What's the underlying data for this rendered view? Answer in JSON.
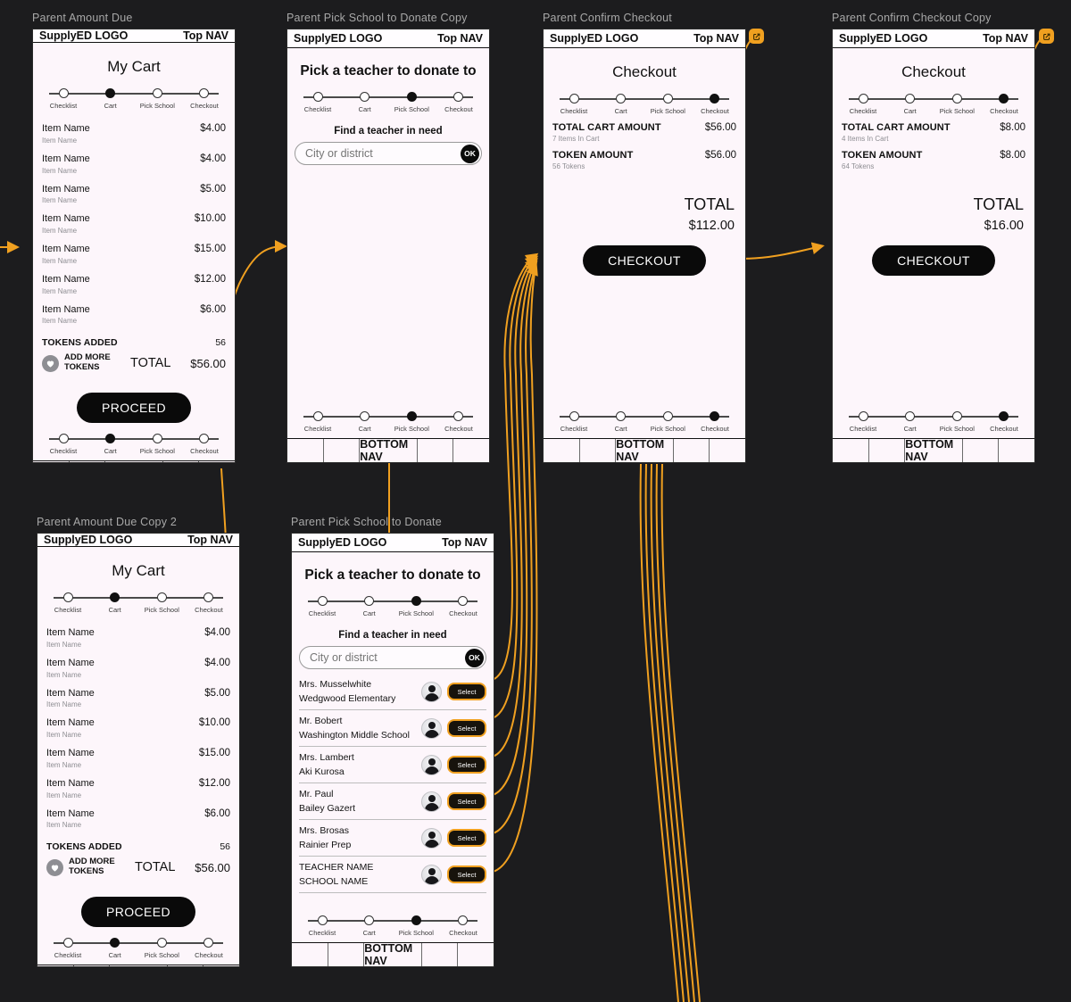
{
  "canvas": {
    "bg": "#1c1c1e",
    "accent": "#f0a020"
  },
  "common": {
    "logo": "SupplyED LOGO",
    "top_nav": "Top NAV",
    "bottom_nav": "BOTTOM NAV",
    "stepper": [
      "Checklist",
      "Cart",
      "Pick School",
      "Checkout"
    ]
  },
  "frames": [
    {
      "title": "Parent Amount Due",
      "screen_title": "My Cart",
      "title_style": "light",
      "active_step": 1,
      "items": [
        {
          "name": "Item Name",
          "sub": "Item Name",
          "price": "$4.00"
        },
        {
          "name": "Item Name",
          "sub": "Item Name",
          "price": "$4.00"
        },
        {
          "name": "Item Name",
          "sub": "Item Name",
          "price": "$5.00"
        },
        {
          "name": "Item Name",
          "sub": "Item Name",
          "price": "$10.00"
        },
        {
          "name": "Item Name",
          "sub": "Item Name",
          "price": "$15.00"
        },
        {
          "name": "Item Name",
          "sub": "Item Name",
          "price": "$12.00"
        },
        {
          "name": "Item Name",
          "sub": "Item Name",
          "price": "$6.00"
        }
      ],
      "tokens_added_label": "TOKENS ADDED",
      "tokens_added_count": "56",
      "add_more_tokens": "ADD MORE TOKENS",
      "total_word": "TOTAL",
      "total_value": "$56.00",
      "cta": "PROCEED"
    },
    {
      "title": "Parent Pick School to Donate Copy",
      "screen_title": "Pick a teacher to donate to",
      "title_style": "bold",
      "active_step": 2,
      "find_label": "Find a teacher in need",
      "search_placeholder": "City or district",
      "search_value": "",
      "ok_label": "OK",
      "teachers": []
    },
    {
      "title": "Parent Confirm Checkout",
      "screen_title": "Checkout",
      "title_style": "light",
      "active_step": 3,
      "summary": [
        {
          "label": "TOTAL CART AMOUNT",
          "sub": "7 Items In Cart",
          "value": "$56.00"
        },
        {
          "label": "TOKEN AMOUNT",
          "sub": "56 Tokens",
          "value": "$56.00"
        }
      ],
      "grand_word": "TOTAL",
      "grand_value": "$112.00",
      "cta": "CHECKOUT",
      "ext_link": true
    },
    {
      "title": "Parent Confirm Checkout Copy",
      "screen_title": "Checkout",
      "title_style": "light",
      "active_step": 3,
      "summary": [
        {
          "label": "TOTAL CART AMOUNT",
          "sub": "4 Items In Cart",
          "value": "$8.00"
        },
        {
          "label": "TOKEN AMOUNT",
          "sub": "64 Tokens",
          "value": "$8.00"
        }
      ],
      "grand_word": "TOTAL",
      "grand_value": "$16.00",
      "cta": "CHECKOUT",
      "ext_link": true
    },
    {
      "title": "Parent Amount Due Copy 2",
      "screen_title": "My Cart",
      "title_style": "light",
      "active_step": 1,
      "items": [
        {
          "name": "Item Name",
          "sub": "Item Name",
          "price": "$4.00"
        },
        {
          "name": "Item Name",
          "sub": "Item Name",
          "price": "$4.00"
        },
        {
          "name": "Item Name",
          "sub": "Item Name",
          "price": "$5.00"
        },
        {
          "name": "Item Name",
          "sub": "Item Name",
          "price": "$10.00"
        },
        {
          "name": "Item Name",
          "sub": "Item Name",
          "price": "$15.00"
        },
        {
          "name": "Item Name",
          "sub": "Item Name",
          "price": "$12.00"
        },
        {
          "name": "Item Name",
          "sub": "Item Name",
          "price": "$6.00"
        }
      ],
      "tokens_added_label": "TOKENS ADDED",
      "tokens_added_count": "56",
      "add_more_tokens": "ADD MORE TOKENS",
      "total_word": "TOTAL",
      "total_value": "$56.00",
      "cta": "PROCEED"
    },
    {
      "title": "Parent Pick School to Donate",
      "screen_title": "Pick a teacher to donate to",
      "title_style": "bold",
      "active_step": 2,
      "find_label": "Find a teacher in need",
      "search_placeholder": "City or district",
      "search_value": "",
      "ok_label": "OK",
      "teachers": [
        {
          "name": "Mrs. Musselwhite",
          "school": "Wedgwood Elementary",
          "action": "Select"
        },
        {
          "name": "Mr. Bobert",
          "school": "Washington Middle School",
          "action": "Select"
        },
        {
          "name": "Mrs. Lambert",
          "school": "Aki Kurosa",
          "action": "Select"
        },
        {
          "name": "Mr. Paul",
          "school": "Bailey Gazert",
          "action": "Select"
        },
        {
          "name": "Mrs. Brosas",
          "school": "Rainier Prep",
          "action": "Select"
        },
        {
          "name": "TEACHER NAME",
          "school": "SCHOOL NAME",
          "action": "Select"
        }
      ]
    }
  ]
}
